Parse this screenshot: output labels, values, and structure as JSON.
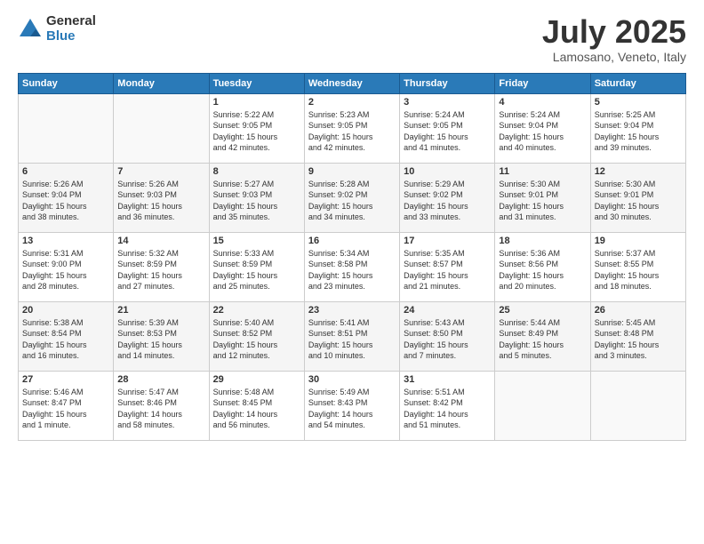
{
  "header": {
    "logo_general": "General",
    "logo_blue": "Blue",
    "title": "July 2025",
    "subtitle": "Lamosano, Veneto, Italy"
  },
  "days_header": [
    "Sunday",
    "Monday",
    "Tuesday",
    "Wednesday",
    "Thursday",
    "Friday",
    "Saturday"
  ],
  "weeks": [
    [
      {
        "day": "",
        "info": ""
      },
      {
        "day": "",
        "info": ""
      },
      {
        "day": "1",
        "info": "Sunrise: 5:22 AM\nSunset: 9:05 PM\nDaylight: 15 hours\nand 42 minutes."
      },
      {
        "day": "2",
        "info": "Sunrise: 5:23 AM\nSunset: 9:05 PM\nDaylight: 15 hours\nand 42 minutes."
      },
      {
        "day": "3",
        "info": "Sunrise: 5:24 AM\nSunset: 9:05 PM\nDaylight: 15 hours\nand 41 minutes."
      },
      {
        "day": "4",
        "info": "Sunrise: 5:24 AM\nSunset: 9:04 PM\nDaylight: 15 hours\nand 40 minutes."
      },
      {
        "day": "5",
        "info": "Sunrise: 5:25 AM\nSunset: 9:04 PM\nDaylight: 15 hours\nand 39 minutes."
      }
    ],
    [
      {
        "day": "6",
        "info": "Sunrise: 5:26 AM\nSunset: 9:04 PM\nDaylight: 15 hours\nand 38 minutes."
      },
      {
        "day": "7",
        "info": "Sunrise: 5:26 AM\nSunset: 9:03 PM\nDaylight: 15 hours\nand 36 minutes."
      },
      {
        "day": "8",
        "info": "Sunrise: 5:27 AM\nSunset: 9:03 PM\nDaylight: 15 hours\nand 35 minutes."
      },
      {
        "day": "9",
        "info": "Sunrise: 5:28 AM\nSunset: 9:02 PM\nDaylight: 15 hours\nand 34 minutes."
      },
      {
        "day": "10",
        "info": "Sunrise: 5:29 AM\nSunset: 9:02 PM\nDaylight: 15 hours\nand 33 minutes."
      },
      {
        "day": "11",
        "info": "Sunrise: 5:30 AM\nSunset: 9:01 PM\nDaylight: 15 hours\nand 31 minutes."
      },
      {
        "day": "12",
        "info": "Sunrise: 5:30 AM\nSunset: 9:01 PM\nDaylight: 15 hours\nand 30 minutes."
      }
    ],
    [
      {
        "day": "13",
        "info": "Sunrise: 5:31 AM\nSunset: 9:00 PM\nDaylight: 15 hours\nand 28 minutes."
      },
      {
        "day": "14",
        "info": "Sunrise: 5:32 AM\nSunset: 8:59 PM\nDaylight: 15 hours\nand 27 minutes."
      },
      {
        "day": "15",
        "info": "Sunrise: 5:33 AM\nSunset: 8:59 PM\nDaylight: 15 hours\nand 25 minutes."
      },
      {
        "day": "16",
        "info": "Sunrise: 5:34 AM\nSunset: 8:58 PM\nDaylight: 15 hours\nand 23 minutes."
      },
      {
        "day": "17",
        "info": "Sunrise: 5:35 AM\nSunset: 8:57 PM\nDaylight: 15 hours\nand 21 minutes."
      },
      {
        "day": "18",
        "info": "Sunrise: 5:36 AM\nSunset: 8:56 PM\nDaylight: 15 hours\nand 20 minutes."
      },
      {
        "day": "19",
        "info": "Sunrise: 5:37 AM\nSunset: 8:55 PM\nDaylight: 15 hours\nand 18 minutes."
      }
    ],
    [
      {
        "day": "20",
        "info": "Sunrise: 5:38 AM\nSunset: 8:54 PM\nDaylight: 15 hours\nand 16 minutes."
      },
      {
        "day": "21",
        "info": "Sunrise: 5:39 AM\nSunset: 8:53 PM\nDaylight: 15 hours\nand 14 minutes."
      },
      {
        "day": "22",
        "info": "Sunrise: 5:40 AM\nSunset: 8:52 PM\nDaylight: 15 hours\nand 12 minutes."
      },
      {
        "day": "23",
        "info": "Sunrise: 5:41 AM\nSunset: 8:51 PM\nDaylight: 15 hours\nand 10 minutes."
      },
      {
        "day": "24",
        "info": "Sunrise: 5:43 AM\nSunset: 8:50 PM\nDaylight: 15 hours\nand 7 minutes."
      },
      {
        "day": "25",
        "info": "Sunrise: 5:44 AM\nSunset: 8:49 PM\nDaylight: 15 hours\nand 5 minutes."
      },
      {
        "day": "26",
        "info": "Sunrise: 5:45 AM\nSunset: 8:48 PM\nDaylight: 15 hours\nand 3 minutes."
      }
    ],
    [
      {
        "day": "27",
        "info": "Sunrise: 5:46 AM\nSunset: 8:47 PM\nDaylight: 15 hours\nand 1 minute."
      },
      {
        "day": "28",
        "info": "Sunrise: 5:47 AM\nSunset: 8:46 PM\nDaylight: 14 hours\nand 58 minutes."
      },
      {
        "day": "29",
        "info": "Sunrise: 5:48 AM\nSunset: 8:45 PM\nDaylight: 14 hours\nand 56 minutes."
      },
      {
        "day": "30",
        "info": "Sunrise: 5:49 AM\nSunset: 8:43 PM\nDaylight: 14 hours\nand 54 minutes."
      },
      {
        "day": "31",
        "info": "Sunrise: 5:51 AM\nSunset: 8:42 PM\nDaylight: 14 hours\nand 51 minutes."
      },
      {
        "day": "",
        "info": ""
      },
      {
        "day": "",
        "info": ""
      }
    ]
  ]
}
